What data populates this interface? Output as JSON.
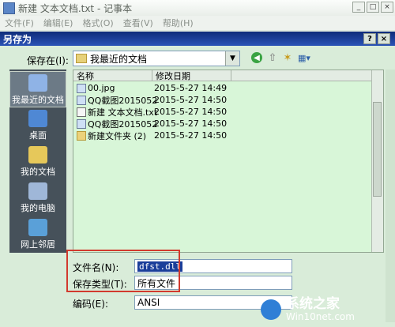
{
  "window": {
    "title": "新建 文本文档.txt - 记事本",
    "menu": [
      "文件(F)",
      "编辑(E)",
      "格式(O)",
      "查看(V)",
      "帮助(H)"
    ]
  },
  "dialog": {
    "title": "另存为",
    "help_button": "?",
    "close_button": "×",
    "save_in_label": "保存在(I):",
    "save_in_value": "我最近的文档",
    "places": [
      {
        "label": "我最近的文档",
        "icon": "recent-docs-icon"
      },
      {
        "label": "桌面",
        "icon": "desktop-icon"
      },
      {
        "label": "我的文档",
        "icon": "my-documents-icon"
      },
      {
        "label": "我的电脑",
        "icon": "my-computer-icon"
      },
      {
        "label": "网上邻居",
        "icon": "network-icon"
      }
    ],
    "columns": {
      "name": "名称",
      "date": "修改日期"
    },
    "files": [
      {
        "name": "00.jpg",
        "date": "2015-5-27 14:49",
        "icon": "image-icon"
      },
      {
        "name": "QQ截图2015052...",
        "date": "2015-5-27 14:50",
        "icon": "image-icon"
      },
      {
        "name": "新建 文本文档.txt",
        "date": "2015-5-27 14:50",
        "icon": "text-file-icon"
      },
      {
        "name": "QQ截图2015052...",
        "date": "2015-5-27 14:50",
        "icon": "image-icon"
      },
      {
        "name": "新建文件夹 (2)",
        "date": "2015-5-27 14:50",
        "icon": "folder-icon"
      }
    ],
    "filename_label": "文件名(N):",
    "filename_value": "dfst.dll",
    "filetype_label": "保存类型(T):",
    "filetype_value": "所有文件",
    "encoding_label": "编码(E):",
    "encoding_value": "ANSI"
  },
  "watermark": {
    "big": "系统之家",
    "small": "Win10net.com"
  },
  "colors": {
    "titlebar": "#1f45a8",
    "highlight_border": "#d23a2e",
    "list_bg": "#d8f6d8"
  }
}
